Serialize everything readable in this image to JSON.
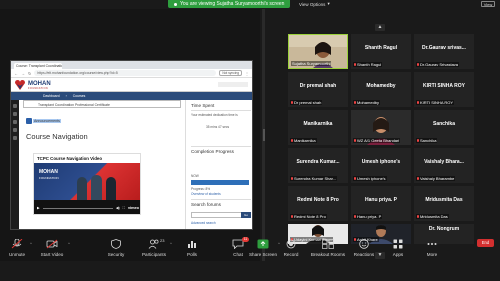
{
  "topbar": {
    "share_banner": "You are viewing Sujatha Suryamoorthi's screen",
    "view_options": "View Options",
    "view_button": "View"
  },
  "shared_screen": {
    "browser": {
      "tab_title": "Course: Transplant Coordinatio...",
      "url": "https://elt.mohanfoundation.org/course/view.php?id=5",
      "not_syncing": "Not syncing"
    },
    "site": {
      "logo_text": "MOHAN",
      "logo_sub": "FOUNDATION",
      "breadcrumbs": [
        "Dashboard",
        "Courses"
      ],
      "program_title": "Transplant Coordination Professional Certificate",
      "announcements": "Announcements",
      "course_navigation": "Course Navigation",
      "video": {
        "title": "TCPC Course Navigation Video",
        "watermark": "MOHAN",
        "watermark_sub": "FOUNDATION",
        "duration": "",
        "player": "vimeo"
      },
      "right": {
        "time_spent": "Time Spent",
        "dedication_text": "Your estimated dedication time is",
        "dedication_value": "35 mins 47 secs",
        "completion_title": "Completion Progress",
        "completion_label": "NOW",
        "progress_text": "Progress: 8%",
        "overview": "Overview of students",
        "search_forums": "Search forums",
        "go_button": "Go",
        "advanced_search": "Advanced search"
      }
    }
  },
  "gallery": {
    "tiles": [
      {
        "name": "",
        "label": "Sujatha Suryamoorthi",
        "type": "photo",
        "active": true
      },
      {
        "name": "Shanth Ragul",
        "label": "Shanth Ragul",
        "type": "name"
      },
      {
        "name": "Dr.Gaurav  srivas...",
        "label": "Dr.Gaurav Srivastava",
        "type": "name"
      },
      {
        "name": "Dr premal shah",
        "label": "Dr premal shah",
        "type": "name"
      },
      {
        "name": "Mohamedby",
        "label": "Mohamedby",
        "type": "name"
      },
      {
        "name": "KIRTI SINHA ROY",
        "label": "KIRTI SINHA ROY",
        "type": "name"
      },
      {
        "name": "Manikarnika",
        "label": "Manikarnika",
        "type": "name"
      },
      {
        "name": "",
        "label": "WZ A/1 Geeta Bhandari",
        "type": "photo"
      },
      {
        "name": "Sanchika",
        "label": "Sanchika",
        "type": "name"
      },
      {
        "name": "Surendra  Kumar...",
        "label": "Surendra Kumar Shar...",
        "type": "name"
      },
      {
        "name": "Umesh iphone's",
        "label": "Umesh iphone's",
        "type": "name"
      },
      {
        "name": "Vaishaly  Bhara...",
        "label": "Vaishaly Bharambe",
        "type": "name"
      },
      {
        "name": "Redmi Note 8 Pro",
        "label": "Redmi Note 8 Pro",
        "type": "name"
      },
      {
        "name": "Hanu priya. P",
        "label": "Hanu priya. P",
        "type": "name"
      },
      {
        "name": "Mridusmita Das",
        "label": "Mridusmita Das",
        "type": "name"
      },
      {
        "name": "",
        "label": "Udayini Kumari Tho...",
        "type": "photo"
      },
      {
        "name": "",
        "label": "Ankit Khare",
        "type": "photo"
      },
      {
        "name": "Dr.  Nongrum",
        "label": "Dr. Nongrum",
        "type": "name"
      }
    ],
    "page_up": "▲",
    "page_down": "▼"
  },
  "toolbar": {
    "unmute": "Unmute",
    "start_video": "Start Video",
    "security": "Security",
    "participants": "Participants",
    "participants_count": "23",
    "polls": "Polls",
    "chat": "Chat",
    "chat_badge": "11",
    "share_screen": "Share Screen",
    "record": "Record",
    "breakout": "Breakout Rooms",
    "reactions": "Reactions",
    "apps": "Apps",
    "more": "More",
    "end": "End"
  },
  "colors": {
    "share_green": "#2e9e3e",
    "active_speaker": "#9bd13a",
    "end_red": "#d32f2f",
    "brand_navy": "#1f3b73"
  }
}
